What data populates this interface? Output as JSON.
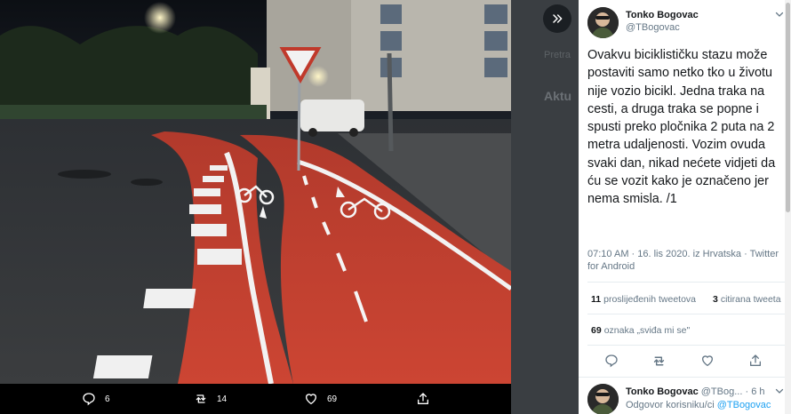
{
  "background": {
    "trends": [
      {
        "text": "Pretra",
        "top": 0
      }
    ],
    "section_title": "Aktu"
  },
  "photo_bar": {
    "reply_count": "6",
    "retweet_count": "14",
    "like_count": "69"
  },
  "tweet": {
    "author_name": "Tonko Bogovac",
    "author_handle": "@TBogovac",
    "text": "Ovakvu biciklističku stazu može postaviti samo netko tko u životu nije vozio bicikl. Jedna traka na cesti, a druga traka se popne i spusti preko pločnika 2 puta na 2 metra udaljenosti. Vozim ovuda svaki dan, nikad nećete vidjeti da ću se vozit kako je označeno jer nema smisla. /1",
    "meta": "07:10 AM · 16. lis 2020. iz Hrvatska · Twitter for Android",
    "retweets_count": "11",
    "retweets_label": "proslijeđenih tweetova",
    "quotes_count": "3",
    "quotes_label": "citirana tweeta",
    "likes_count": "69",
    "likes_label": "oznaka „sviđa mi se\""
  },
  "reply": {
    "author_name": "Tonko Bogovac",
    "author_handle": "@TBog...",
    "time": "· 6 h",
    "reply_prefix": "Odgovor korisniku/ci",
    "reply_target": "@TBogovac"
  },
  "colors": {
    "accent": "#1da1f2",
    "lane_red": "#c9412f",
    "text_primary": "#14171a",
    "text_secondary": "#657786"
  },
  "icons": [
    "expand-chevrons-icon",
    "reply-icon",
    "retweet-icon",
    "like-icon",
    "share-icon",
    "chevron-down-icon"
  ]
}
